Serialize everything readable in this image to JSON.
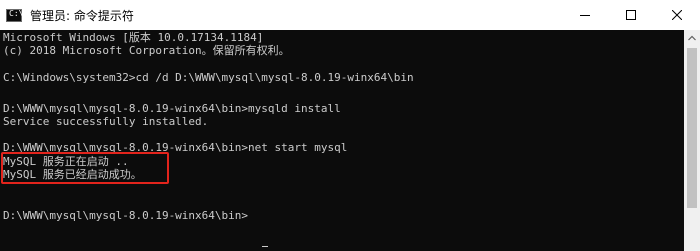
{
  "window": {
    "title": "管理员: 命令提示符",
    "icon": "cmd-icon",
    "icon_glyph": "C:\\"
  },
  "controls": {
    "minimize_icon": "minimize-icon",
    "maximize_icon": "maximize-icon",
    "close_icon": "close-icon"
  },
  "console": {
    "lines": [
      "Microsoft Windows [版本 10.0.17134.1184]",
      "(c) 2018 Microsoft Corporation。保留所有权利。",
      "",
      "C:\\Windows\\system32>cd /d D:\\WWW\\mysql\\mysql-8.0.19-winx64\\bin",
      "",
      "D:\\WWW\\mysql\\mysql-8.0.19-winx64\\bin>mysqld install",
      "Service successfully installed.",
      "",
      "D:\\WWW\\mysql\\mysql-8.0.19-winx64\\bin>net start mysql",
      "MySQL 服务正在启动 ..",
      "MySQL 服务已经启动成功。",
      "",
      "",
      "D:\\WWW\\mysql\\mysql-8.0.19-winx64\\bin>"
    ]
  },
  "colors": {
    "console_bg": "#0c0c0c",
    "console_text": "#cccccc",
    "highlight": "#e3241c"
  }
}
